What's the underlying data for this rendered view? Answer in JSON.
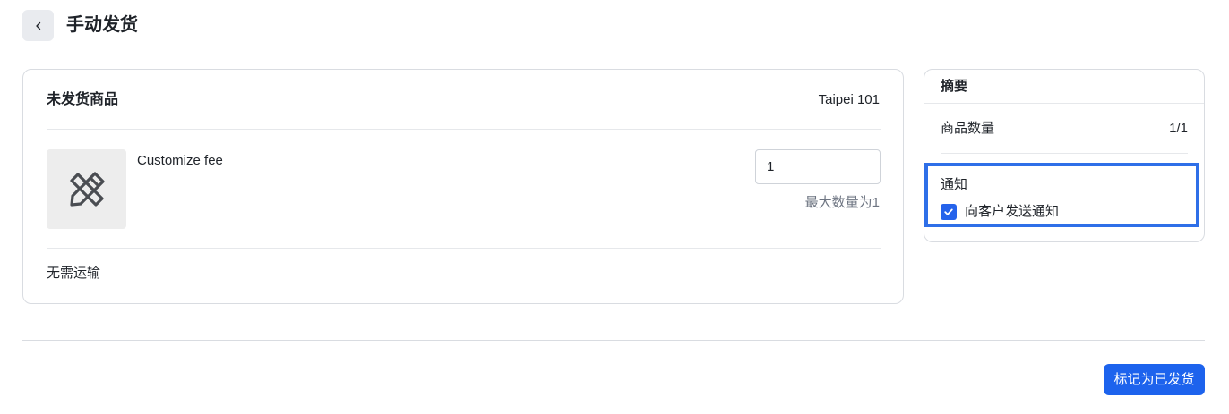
{
  "header": {
    "title": "手动发货",
    "back_icon": "chevron-left-icon"
  },
  "unfulfilled": {
    "title": "未发货商品",
    "location": "Taipei 101",
    "item": {
      "name": "Customize fee",
      "icon": "pencil-ruler-icon",
      "quantity_value": "1",
      "max_hint": "最大数量为1"
    },
    "shipping_note": "无需运输"
  },
  "summary": {
    "title": "摘要",
    "item_count_label": "商品数量",
    "item_count_value": "1/1",
    "notification": {
      "title": "通知",
      "checkbox_label": "向客户发送通知",
      "checked": true
    }
  },
  "footer": {
    "primary_button_label": "标记为已发货"
  },
  "colors": {
    "primary": "#1d63ed",
    "highlight_border": "#2e6fe8",
    "checkbox": "#2563eb"
  }
}
